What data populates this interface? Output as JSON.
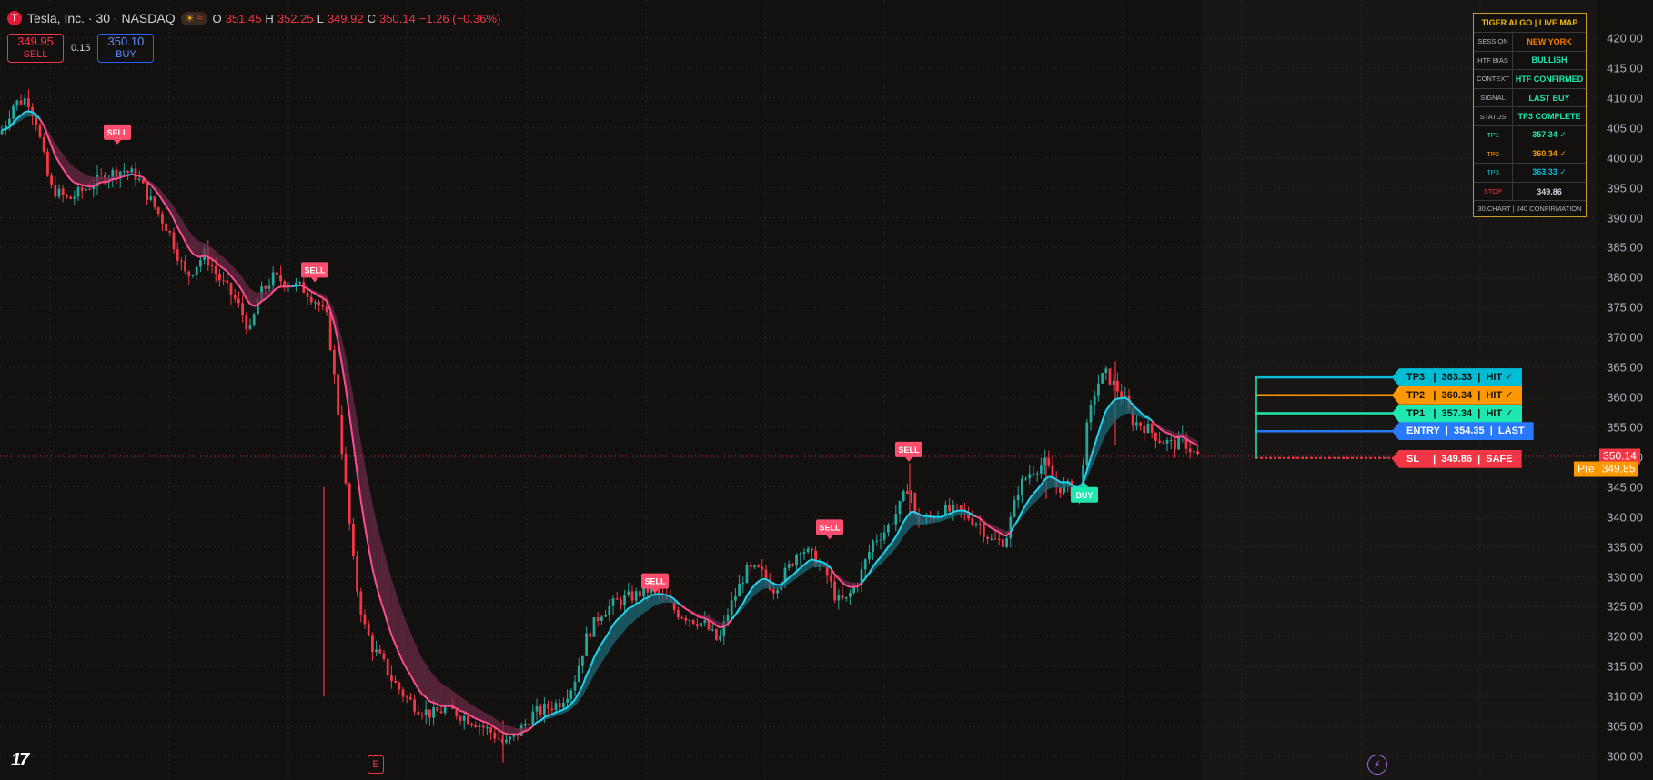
{
  "header": {
    "ticker_icon": "T",
    "title": "Tesla, Inc. · 30 · NASDAQ",
    "session_icons": [
      "sun-icon",
      "wave-icon"
    ],
    "ohlc": {
      "o_label": "O",
      "o": "351.45",
      "h_label": "H",
      "h": "352.25",
      "l_label": "L",
      "l": "349.92",
      "c_label": "C",
      "c": "350.14",
      "chg": "−1.26 (−0.36%)"
    }
  },
  "trade": {
    "sell_price": "349.95",
    "sell_label": "SELL",
    "spread": "0.15",
    "buy_price": "350.10",
    "buy_label": "BUY"
  },
  "panel": {
    "title": "TIGER ALGO | LIVE MAP",
    "rows": [
      {
        "label": "SESSION",
        "value": "NEW YORK",
        "color": "#f57c00"
      },
      {
        "label": "HTF BIAS",
        "value": "BULLISH",
        "color": "#1ee8b0"
      },
      {
        "label": "CONTEXT",
        "value": "HTF CONFIRMED",
        "color": "#1ee8b0"
      },
      {
        "label": "SIGNAL",
        "value": "LAST BUY",
        "color": "#1ee8b0"
      },
      {
        "label": "STATUS",
        "value": "TP3 COMPLETE",
        "color": "#1ee8b0"
      },
      {
        "label": "TP1",
        "value": "357.34 ✓",
        "color": "#1ee8b0",
        "label_color": "#1ee8b0"
      },
      {
        "label": "TP2",
        "value": "360.34 ✓",
        "color": "#ff9800",
        "label_color": "#ff9800"
      },
      {
        "label": "TP3",
        "value": "363.33 ✓",
        "color": "#00bcd4",
        "label_color": "#00bcd4"
      },
      {
        "label": "STOP",
        "value": "349.86",
        "color": "#d1d4dc",
        "label_color": "#f23645"
      }
    ],
    "footer": "30 CHART | 240 CONFIRMATION"
  },
  "levels": [
    {
      "name": "TP3",
      "text": "TP3   |  363.33  |  HIT ✓",
      "price": 363.33,
      "color": "#00bcd4"
    },
    {
      "name": "TP2",
      "text": "TP2   |  360.34  |  HIT ✓",
      "price": 360.34,
      "color": "#ff9800"
    },
    {
      "name": "TP1",
      "text": "TP1   |  357.34  |  HIT ✓",
      "price": 357.34,
      "color": "#1ee8b0"
    },
    {
      "name": "ENTRY",
      "text": "ENTRY  |  354.35  |  LAST",
      "price": 354.35,
      "color": "#2979ff"
    },
    {
      "name": "SL",
      "text": "SL     |  349.86  |  SAFE",
      "price": 349.86,
      "color": "#f23645"
    }
  ],
  "price_badges": {
    "last": "350.14",
    "last_color": "#f23645",
    "pre_label": "Pre",
    "pre": "349.85",
    "pre_color": "#ff9800"
  },
  "chart_data": {
    "type": "candlestick",
    "ylim": [
      298,
      425
    ],
    "y_ticks": [
      300,
      305,
      310,
      315,
      320,
      325,
      330,
      335,
      340,
      345,
      350,
      355,
      360,
      365,
      370,
      375,
      380,
      385,
      390,
      395,
      400,
      405,
      410,
      415,
      420
    ],
    "grid": true,
    "colors": {
      "up": "#26a69a",
      "down": "#f23645",
      "fast_bear": "#ff4d8f",
      "fast_bull": "#22d3ee"
    },
    "path_points": [
      [
        0,
        404
      ],
      [
        15,
        409
      ],
      [
        30,
        410
      ],
      [
        40,
        406
      ],
      [
        55,
        395
      ],
      [
        75,
        393
      ],
      [
        95,
        395
      ],
      [
        115,
        397
      ],
      [
        135,
        398
      ],
      [
        150,
        397
      ],
      [
        165,
        393
      ],
      [
        185,
        388
      ],
      [
        205,
        380
      ],
      [
        225,
        384
      ],
      [
        240,
        380
      ],
      [
        260,
        376
      ],
      [
        275,
        371
      ],
      [
        285,
        377
      ],
      [
        300,
        380
      ],
      [
        320,
        379
      ],
      [
        335,
        378
      ],
      [
        348,
        376
      ],
      [
        360,
        373
      ],
      [
        370,
        360
      ],
      [
        380,
        345
      ],
      [
        390,
        330
      ],
      [
        400,
        322
      ],
      [
        410,
        318
      ],
      [
        420,
        316
      ],
      [
        430,
        313
      ],
      [
        445,
        310
      ],
      [
        460,
        308
      ],
      [
        475,
        307
      ],
      [
        490,
        308
      ],
      [
        505,
        307
      ],
      [
        520,
        306
      ],
      [
        540,
        304
      ],
      [
        555,
        302
      ],
      [
        570,
        304
      ],
      [
        585,
        307
      ],
      [
        600,
        308
      ],
      [
        615,
        309
      ],
      [
        630,
        312
      ],
      [
        645,
        320
      ],
      [
        660,
        324
      ],
      [
        680,
        326
      ],
      [
        700,
        327
      ],
      [
        715,
        328
      ],
      [
        725,
        327
      ],
      [
        745,
        324
      ],
      [
        760,
        323
      ],
      [
        775,
        322
      ],
      [
        790,
        319
      ],
      [
        800,
        324
      ],
      [
        820,
        331
      ],
      [
        835,
        331
      ],
      [
        850,
        328
      ],
      [
        865,
        331
      ],
      [
        880,
        335
      ],
      [
        895,
        333
      ],
      [
        910,
        330
      ],
      [
        920,
        326
      ],
      [
        930,
        326
      ],
      [
        945,
        330
      ],
      [
        960,
        336
      ],
      [
        975,
        338
      ],
      [
        990,
        342
      ],
      [
        1000,
        346
      ],
      [
        1005,
        340
      ],
      [
        1015,
        339
      ],
      [
        1035,
        341
      ],
      [
        1055,
        341
      ],
      [
        1075,
        339
      ],
      [
        1090,
        336
      ],
      [
        1105,
        336
      ],
      [
        1120,
        345
      ],
      [
        1135,
        348
      ],
      [
        1150,
        349
      ],
      [
        1160,
        345
      ],
      [
        1175,
        345
      ],
      [
        1185,
        343
      ],
      [
        1195,
        355
      ],
      [
        1205,
        362
      ],
      [
        1215,
        364
      ],
      [
        1225,
        362
      ],
      [
        1235,
        360
      ],
      [
        1245,
        356
      ],
      [
        1260,
        355
      ],
      [
        1275,
        353
      ],
      [
        1290,
        352
      ],
      [
        1300,
        353
      ],
      [
        1310,
        351
      ],
      [
        1317,
        350.14
      ]
    ],
    "signals": [
      {
        "type": "SELL",
        "x": 129,
        "price": 403
      },
      {
        "type": "SELL",
        "x": 346,
        "price": 380
      },
      {
        "type": "SELL",
        "x": 720,
        "price": 328
      },
      {
        "type": "SELL",
        "x": 912,
        "price": 337
      },
      {
        "type": "SELL",
        "x": 999,
        "price": 350
      },
      {
        "type": "BUY",
        "x": 1192,
        "price": 345
      }
    ],
    "last_price": 350.14
  }
}
